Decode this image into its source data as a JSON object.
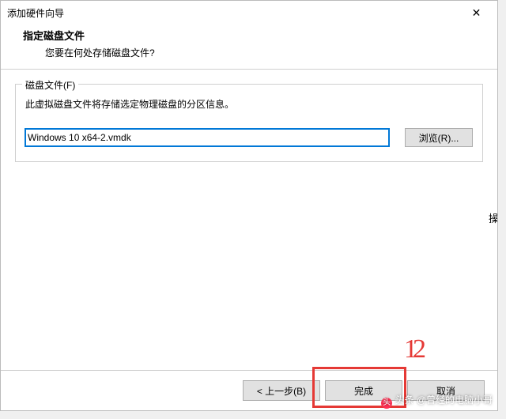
{
  "titlebar": {
    "title": "添加硬件向导",
    "close_glyph": "✕"
  },
  "header": {
    "title": "指定磁盘文件",
    "subtitle": "您要在何处存储磁盘文件?"
  },
  "disk_file": {
    "legend": "磁盘文件(F)",
    "description": "此虚拟磁盘文件将存储选定物理磁盘的分区信息。",
    "value": "Windows 10 x64-2.vmdk",
    "browse_label": "浏览(R)..."
  },
  "footer": {
    "back": "< 上一步(B)",
    "finish": "完成",
    "cancel": "取消"
  },
  "annotation": {
    "number": "12"
  },
  "right_partial": "操",
  "watermark": {
    "prefix": "头条",
    "author": "@曾经的电脑小哥"
  }
}
